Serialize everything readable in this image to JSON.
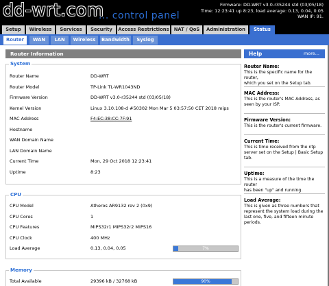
{
  "header": {
    "logo": "dd-wrt.com",
    "subtitle": "... control panel",
    "firmware": "Firmware: DD-WRT v3.0-r35244 std (03/05/18)",
    "time": "Time: 12:23:41 up 8:23, load average: 0.13, 0.04, 0.05",
    "wan_ip": "WAN IP: 91."
  },
  "tabs": [
    "Setup",
    "Wireless",
    "Services",
    "Security",
    "Access Restrictions",
    "NAT / QoS",
    "Administration",
    "Status"
  ],
  "subtabs": [
    "Router",
    "WAN",
    "LAN",
    "Wireless",
    "Bandwidth",
    "Syslog"
  ],
  "main": {
    "title": "Router Information",
    "system": {
      "legend": "System",
      "rows": [
        {
          "label": "Router Name",
          "value": "DD-WRT"
        },
        {
          "label": "Router Model",
          "value": "TP-Link TL-WR1043ND"
        },
        {
          "label": "Firmware Version",
          "value": "DD-WRT v3.0-r35244 std (03/05/18)"
        },
        {
          "label": "Kernel Version",
          "value": "Linux 3.10.108-d #50302 Mon Mar 5 03:57:50 CET 2018 mips"
        },
        {
          "label": "MAC Address",
          "value": "F4:EC:38:CC:7F:91"
        },
        {
          "label": "Hostname",
          "value": ""
        },
        {
          "label": "WAN Domain Name",
          "value": ""
        },
        {
          "label": "LAN Domain Name",
          "value": ""
        },
        {
          "label": "Current Time",
          "value": "Mon, 29 Oct 2018 12:23:41"
        },
        {
          "label": "Uptime",
          "value": "8:23"
        }
      ]
    },
    "cpu": {
      "legend": "CPU",
      "rows": [
        {
          "label": "CPU Model",
          "value": "Atheros AR9132 rev 2 (0x9)"
        },
        {
          "label": "CPU Cores",
          "value": "1"
        },
        {
          "label": "CPU Features",
          "value": "MIPS32r1 MIPS32r2 MIPS16"
        },
        {
          "label": "CPU Clock",
          "value": "400 MHz"
        },
        {
          "label": "Load Average",
          "value": "0.13, 0.04, 0.05"
        }
      ],
      "load_bar": {
        "text": "7%",
        "fraction": 0.07
      }
    },
    "memory": {
      "legend": "Memory",
      "rows": [
        {
          "label": "Total Available",
          "value": "29396 kB / 32768 kB"
        }
      ],
      "mem_bar": {
        "text": "90%",
        "fraction": 0.9
      }
    }
  },
  "help": {
    "title": "Help",
    "more": "more...",
    "items": [
      {
        "heading": "Router Name:",
        "lines": [
          "This is the specific name for the router,",
          "which you set on the Setup tab."
        ]
      },
      {
        "heading": "MAC Address:",
        "lines": [
          "This is the router's MAC Address, as",
          "seen by your ISP."
        ]
      },
      {
        "heading": "Firmware Version:",
        "lines": [
          "This is the router's current firmware."
        ]
      },
      {
        "heading": "Current Time:",
        "lines": [
          "This is time received from the ntp",
          "server set on the Setup | Basic Setup",
          "tab."
        ]
      },
      {
        "heading": "Uptime:",
        "lines": [
          "This is a measure of the time the router",
          "has been \"up\" and running."
        ]
      },
      {
        "heading": "Load Average:",
        "lines": [
          "This is given as three numbers that",
          "represent the system load during the",
          "last one, five, and fifteen minute",
          "periods."
        ]
      }
    ]
  },
  "colors": {
    "accent_blue": "#3a6fd0",
    "tab_inactive": "#d4d4d4",
    "subtab_inactive": "#6b93d8",
    "title_bar": "#808080",
    "legend_text": "#2c6fd6",
    "bar_fill": "#3a78d8"
  }
}
